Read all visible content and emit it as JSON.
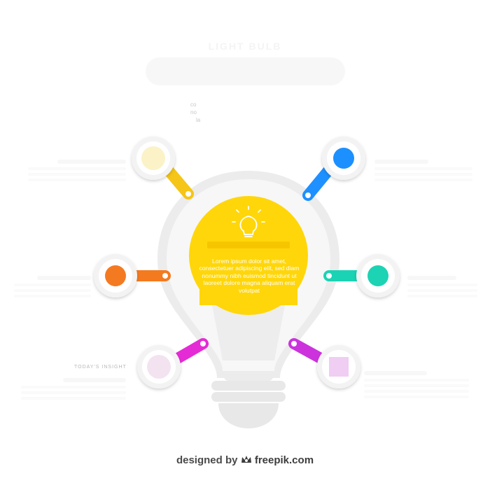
{
  "header": {
    "title": "LIGHT BULB",
    "intro_lines": [
      "co",
      "no",
      "la"
    ]
  },
  "center": {
    "icon": "lightbulb-icon",
    "text": "Lorem ipsum dolor sit amet, consectetuer adipiscing elit, sed diam nonummy nibh euismod tincidunt ut laoreet dolore magna aliquam erat volutpat"
  },
  "options": [
    {
      "id": "top-left",
      "color": "#f5c518",
      "inner": "#fbf2c8"
    },
    {
      "id": "top-right",
      "color": "#1e90ff",
      "inner": "#1e90ff"
    },
    {
      "id": "mid-left",
      "color": "#f47a20",
      "inner": "#f47a20"
    },
    {
      "id": "mid-right",
      "color": "#1ad3b4",
      "inner": "#1ad3b4"
    },
    {
      "id": "bottom-left",
      "color": "#e52bd6",
      "inner": "#f3e3f1"
    },
    {
      "id": "bottom-right",
      "color": "#cc33dd",
      "inner": "#f0cdf3"
    }
  ],
  "bulb": {
    "color": "#f5f5f5",
    "outline": "#ececec",
    "accent": "#ffd60a"
  },
  "side_label": "TODAY'S INSIGHT",
  "credit": {
    "prefix": "designed by",
    "brand": "freepik.com",
    "icon": "freepik-crown-icon"
  }
}
